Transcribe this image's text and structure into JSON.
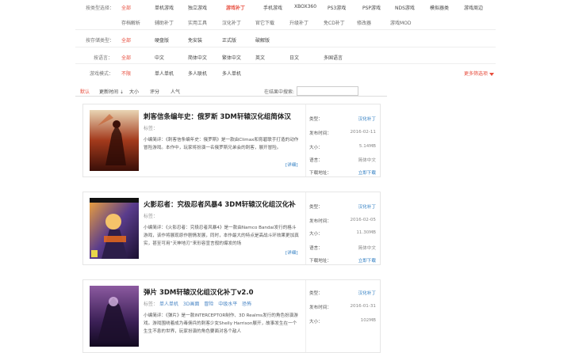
{
  "filters": {
    "type_label": "按类型选择：",
    "type_row1": [
      "全部",
      "单机游戏",
      "独立游戏",
      "游戏补丁",
      "手机游戏",
      "XBOX360",
      "PS3游戏",
      "PSP游戏",
      "NDS游戏",
      "模拟器类",
      "游戏周边"
    ],
    "type_current": "游戏补丁",
    "type_row2": [
      "存档解析",
      "辅助补丁",
      "实用工具",
      "汉化补丁",
      "官它下载",
      "升级补丁",
      "免CD补丁",
      "修改器",
      "游戏MOD"
    ],
    "env_label": "按存储类型：",
    "env_items": [
      "全部",
      "硬盘版",
      "免安装",
      "正式版",
      "破解版"
    ],
    "lang_label": "按语言：",
    "lang_items": [
      "全部",
      "中文",
      "简体中文",
      "繁体中文",
      "英文",
      "日文",
      "多国语言"
    ],
    "mode_label": "游戏模式：",
    "mode_items": [
      "不限",
      "单人单机",
      "多人联机",
      "多人单机"
    ],
    "more": "更多筛选项"
  },
  "sortbar": {
    "items": [
      "默认",
      "更新时间 ⇣",
      "大小",
      "评分",
      "人气"
    ],
    "search_label": "在结果中搜索:"
  },
  "list": [
    {
      "title": "刺客信条编年史：俄罗斯 3DM轩辕汉化组简体汉",
      "tags_label": "标签：",
      "tags": [],
      "desc": "小编简评：《刺客信条编年史：俄罗斯》是一款由Climax和育碧联手打造的动作冒险游戏。本作中，玩家将扮演一名俄罗斯兄弟会的刺客，展开冒险。",
      "detail": "[详细]",
      "info": {
        "type_label": "类型：",
        "type": "汉化补丁",
        "date_label": "发布时间：",
        "date": "2016-02-11",
        "size_label": "大小：",
        "size": "5.14MB",
        "lang_label": "语言：",
        "lang": "简体中文",
        "dl_label": "下载地址：",
        "dl": "立即下载"
      }
    },
    {
      "title": "火影忍者：究极忍者风暴4 3DM轩辕汉化组汉化补",
      "tags_label": "标签：",
      "tags": [],
      "desc": "小编简评：《火影忍者：究极忍者风暴4》是一款由Namco Bandai发行的格斗游戏，该作将展现原作剧情发展，同时，本作最大的特点是高战斗环效果更加真实，甚至可用“天神地刃”来形容宣言般的爆发的场",
      "detail": "[详细]",
      "info": {
        "type_label": "类型：",
        "type": "汉化补丁",
        "date_label": "发布时间：",
        "date": "2016-02-05",
        "size_label": "大小：",
        "size": "11.30MB",
        "lang_label": "语言：",
        "lang": "简体中文",
        "dl_label": "下载地址：",
        "dl": "立即下载"
      }
    },
    {
      "title": "弹片 3DM轩辕汉化组汉化补丁v2.0",
      "tags_label": "标签：",
      "tags": [
        "单人单机",
        "3D画面",
        "冒险",
        "中级水平",
        "恐怖"
      ],
      "desc": "小编简评：《弹片》是一款INTERCEPTOR制作、3D Realms发行的角色扮演游戏。游戏围绕着成为毒佣兵的刺客少女Shelly Harrison展开，故事发生在一个生生不息的世界，玩家扮演的角色要面对各个敌人",
      "detail": "[详细]",
      "info": {
        "type_label": "类型：",
        "type": "汉化补丁",
        "date_label": "发布时间：",
        "date": "2016-01-31",
        "size_label": "大小：",
        "size": "102MB",
        "lang_label": "语言：",
        "lang": "简体中文",
        "dl_label": "下载地址：",
        "dl": "立即下载"
      }
    }
  ]
}
